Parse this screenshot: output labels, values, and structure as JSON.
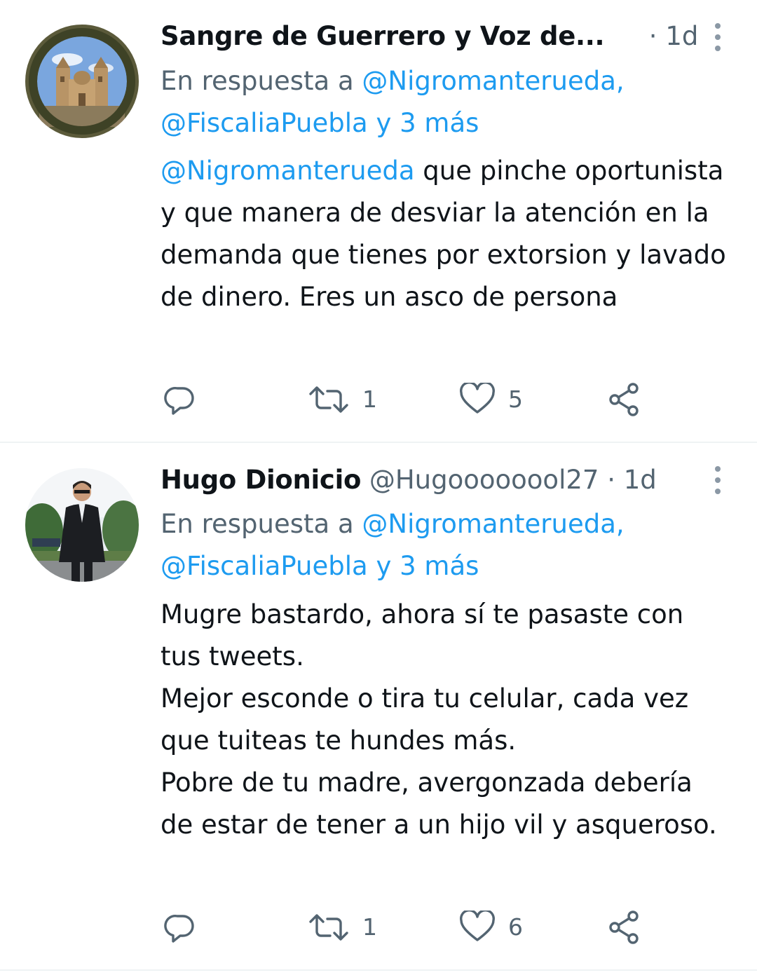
{
  "tweets": [
    {
      "author_name": "Sangre de Guerrero y Voz de...",
      "handle": "",
      "separator": "·",
      "time": "1d",
      "reply_prefix": "En respuesta a",
      "reply_line1": "@Nigromanterueda,",
      "reply_line2": "@FiscaliaPuebla y 3 más",
      "mention": "@Nigromanterueda",
      "body_rest": " que pinche oportunista y que manera de desviar la atención en la demanda que tienes por extorsion y lavado de dinero. Eres un asco de persona",
      "retweets": "1",
      "likes": "5",
      "avatar_icon": "cathedral-avatar"
    },
    {
      "author_name": "Hugo Dionicio",
      "handle": "@Hugoooooool27",
      "separator": "·",
      "time": "1d",
      "reply_prefix": "En respuesta a",
      "reply_line1": "@Nigromanterueda,",
      "reply_line2": "@FiscaliaPuebla y 3 más",
      "body_lines": [
        "Mugre bastardo, ahora sí te pasaste con tus tweets.",
        "Mejor esconde o tira tu celular, cada vez que tuiteas te hundes más.",
        "Pobre de tu madre, avergonzada debería de estar de tener a un hijo vil y asqueroso."
      ],
      "retweets": "1",
      "likes": "6",
      "avatar_icon": "man-in-suit-avatar"
    }
  ],
  "colors": {
    "link": "#1d9bf0",
    "secondary": "#536471",
    "text": "#0f1419",
    "divider": "#eff3f4"
  },
  "icons": [
    "reply-icon",
    "retweet-icon",
    "like-icon",
    "share-icon",
    "more-options-icon"
  ]
}
